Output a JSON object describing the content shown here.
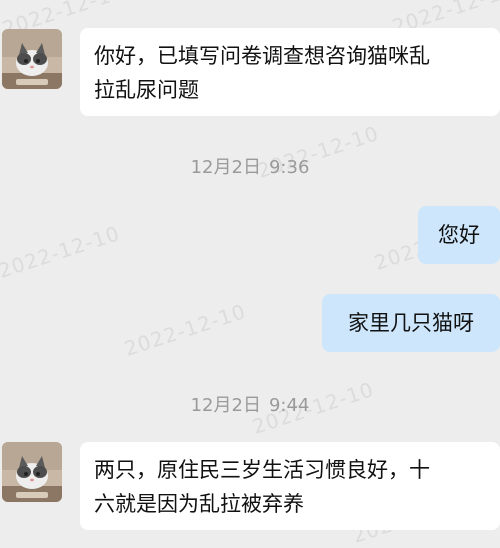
{
  "watermark_text": "2022-12-10",
  "messages": [
    {
      "sender": "customer",
      "text_line1": "你好，已填写问卷调查想咨询猫咪乱",
      "text_line2": "拉乱尿问题"
    },
    {
      "type": "time",
      "date": "12月2日",
      "time": "9:36"
    },
    {
      "sender": "agent",
      "text": "您好"
    },
    {
      "sender": "agent",
      "text": "家里几只猫呀"
    },
    {
      "type": "time",
      "date": "12月2日",
      "time": "9:44"
    },
    {
      "sender": "customer",
      "text_line1": "两只，原住民三岁生活习惯良好，十",
      "text_line2": "六就是因为乱拉被弃养"
    }
  ],
  "colors": {
    "background": "#ededed",
    "incoming_bubble": "#ffffff",
    "outgoing_bubble": "#cde6fb",
    "timestamp": "#9a9a9a"
  },
  "icons": {
    "customer_avatar": "cat-photo-avatar"
  }
}
